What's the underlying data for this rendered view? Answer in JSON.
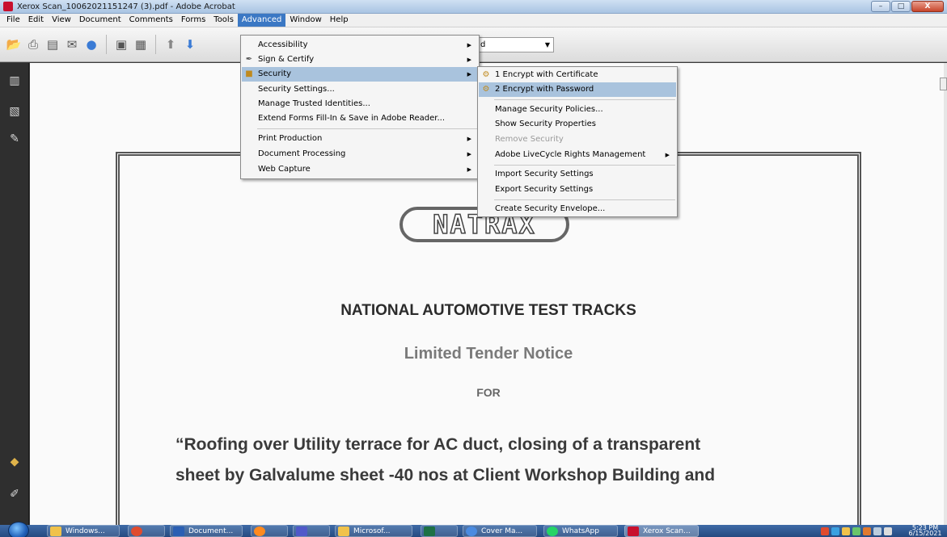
{
  "window": {
    "title": "Xerox Scan_10062021151247 (3).pdf - Adobe Acrobat",
    "controls": {
      "minimize": "–",
      "maximize": "□",
      "close": "X"
    }
  },
  "menubar": {
    "items": [
      "File",
      "Edit",
      "View",
      "Document",
      "Comments",
      "Forms",
      "Tools",
      "Advanced",
      "Window",
      "Help"
    ],
    "active": "Advanced"
  },
  "toolbar": {
    "combo_value": "d",
    "icons": [
      "open-icon",
      "print-icon",
      "save-icon",
      "email-icon",
      "collaborate-icon",
      "fit-page-icon",
      "fit-width-icon",
      "previous-page-icon",
      "next-page-icon"
    ]
  },
  "advanced_menu": {
    "items": [
      {
        "label": "Accessibility",
        "submenu": true
      },
      {
        "label": "Sign & Certify",
        "submenu": true,
        "icon": "pen-icon"
      },
      {
        "label": "Security",
        "submenu": true,
        "icon": "lock-icon",
        "highlighted": true
      },
      {
        "label": "Security Settings...",
        "submenu": false
      },
      {
        "label": "Manage Trusted Identities...",
        "submenu": false
      },
      {
        "label": "Extend Forms Fill-In & Save in Adobe Reader...",
        "submenu": false
      },
      {
        "label": "Print Production",
        "submenu": true
      },
      {
        "label": "Document Processing",
        "submenu": true
      },
      {
        "label": "Web Capture",
        "submenu": true
      }
    ]
  },
  "security_menu": {
    "items": [
      {
        "label": "1 Encrypt with Certificate",
        "icon": "certificate-icon"
      },
      {
        "label": "2 Encrypt with Password",
        "icon": "password-icon",
        "highlighted": true
      },
      {
        "label": "Manage Security Policies..."
      },
      {
        "label": "Show Security Properties"
      },
      {
        "label": "Remove Security",
        "disabled": true
      },
      {
        "label": "Adobe LiveCycle Rights Management",
        "submenu": true
      },
      {
        "label": "Import Security Settings"
      },
      {
        "label": "Export Security Settings"
      },
      {
        "label": "Create Security Envelope..."
      }
    ]
  },
  "document": {
    "logo_text": "NATRAX",
    "heading": "NATIONAL AUTOMOTIVE TEST TRACKS",
    "subheading": "Limited Tender Notice",
    "for_text": "FOR",
    "body_lines": [
      "“Roofing over Utility terrace for AC duct, closing of a transparent",
      "sheet by Galvalume sheet -40 nos at Client Workshop Building and"
    ]
  },
  "taskbar": {
    "tasks": [
      {
        "label": "Windows...",
        "color": "#f0c24b"
      },
      {
        "label": "",
        "color": "#e04b2f"
      },
      {
        "label": "Document...",
        "color": "#2b5fb3"
      },
      {
        "label": "",
        "color": "#ff8a1f"
      },
      {
        "label": "",
        "color": "#5059c9"
      },
      {
        "label": "Microsof...",
        "color": "#f0c24b"
      },
      {
        "label": "",
        "color": "#1e7145"
      },
      {
        "label": "Cover Ma...",
        "color": "#4b8be0"
      },
      {
        "label": "WhatsApp",
        "color": "#25d366"
      },
      {
        "label": "Xerox Scan...",
        "color": "#c8102e"
      }
    ],
    "time": "5:23 PM",
    "date": "6/15/2021"
  },
  "colors": {
    "menu_highlight": "#a9c3dd",
    "menubar_active": "#3b78c4",
    "taskbar": "#2f5a93"
  }
}
